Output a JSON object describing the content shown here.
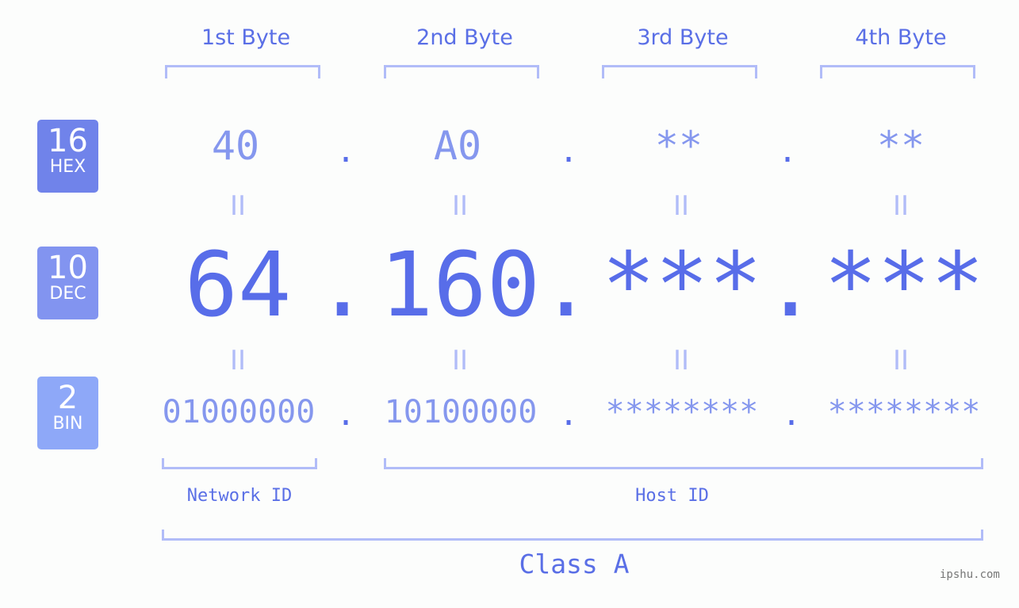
{
  "byte_headers": [
    "1st Byte",
    "2nd Byte",
    "3rd Byte",
    "4th Byte"
  ],
  "rows": {
    "hex": {
      "base": "16",
      "label": "HEX",
      "color": "#7083ea",
      "values": [
        "40",
        "A0",
        "**",
        "**"
      ]
    },
    "dec": {
      "base": "10",
      "label": "DEC",
      "color": "#8294f0",
      "values": [
        "64",
        "160",
        "***",
        "***"
      ]
    },
    "bin": {
      "base": "2",
      "label": "BIN",
      "color": "#8ea8f8",
      "values": [
        "01000000",
        "10100000",
        "********",
        "********"
      ]
    }
  },
  "separator": ".",
  "equals": "II",
  "network_label": "Network ID",
  "host_label": "Host ID",
  "class_label": "Class A",
  "watermark": "ipshu.com"
}
